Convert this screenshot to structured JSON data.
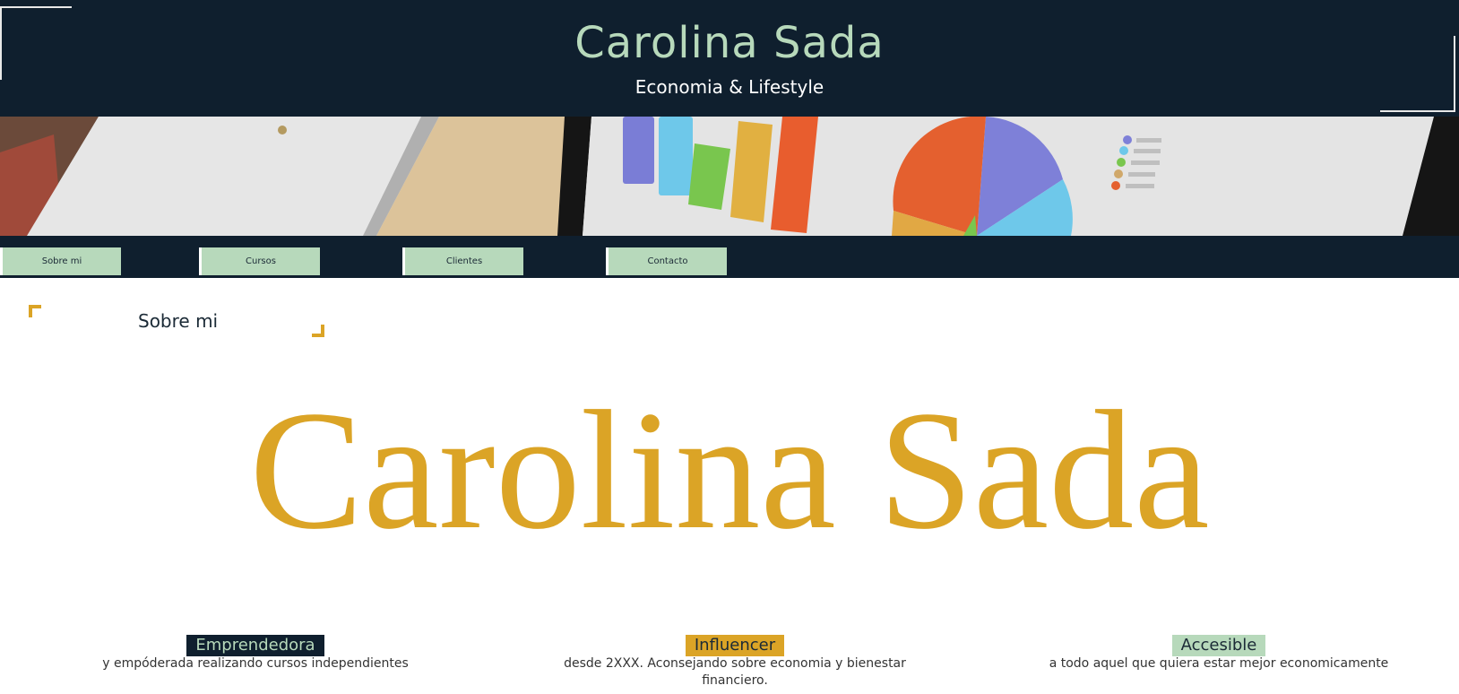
{
  "header": {
    "title": "Carolina Sada",
    "subtitle": "Economia & Lifestyle"
  },
  "nav": {
    "items": [
      {
        "label": "Sobre mi"
      },
      {
        "label": "Cursos"
      },
      {
        "label": "Clientes"
      },
      {
        "label": "Contacto"
      }
    ]
  },
  "section": {
    "title": "Sobre mi"
  },
  "hero": {
    "name": "Carolina Sada"
  },
  "features": [
    {
      "label": "Emprendedora",
      "desc": "y empóderada realizando cursos independientes",
      "bg": "#0f1f2e",
      "fg": "#b7d9bb"
    },
    {
      "label": "Influencer",
      "desc": "desde 2XXX. Aconsejando sobre economia y bienestar financiero.",
      "bg": "#dba426",
      "fg": "#1b2a36"
    },
    {
      "label": "Accesible",
      "desc": "a todo aquel que quiera estar mejor economicamente",
      "bg": "#b7d9bb",
      "fg": "#1b2a36"
    }
  ],
  "colors": {
    "navy": "#0f1f2e",
    "mint": "#b7d9bb",
    "gold": "#dba426"
  }
}
